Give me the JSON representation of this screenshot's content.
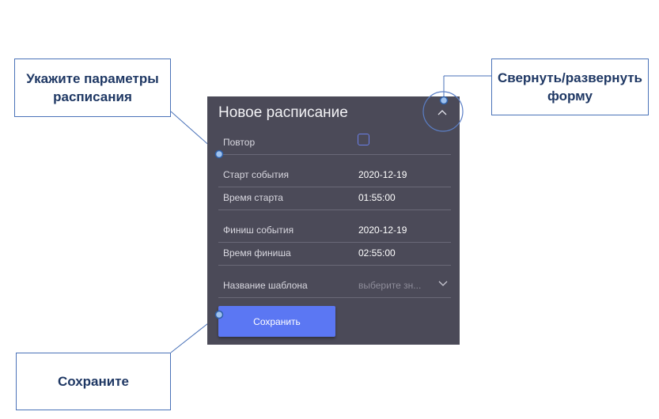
{
  "panel": {
    "title": "Новое расписание",
    "rows": [
      {
        "label": "Повтор",
        "type": "checkbox",
        "checked": false
      },
      {
        "label": "Старт события",
        "value": "2020-12-19"
      },
      {
        "label": "Время старта",
        "value": "01:55:00"
      },
      {
        "label": "Финиш события",
        "value": "2020-12-19"
      },
      {
        "label": "Время финиша",
        "value": "02:55:00"
      },
      {
        "label": "Название шаблона",
        "placeholder": "выберите зн..."
      }
    ],
    "save_label": "Сохранить",
    "colors": {
      "background": "#4b4a58",
      "button": "#5b77f3",
      "accent": "#6b7fe8"
    }
  },
  "callouts": {
    "params": {
      "line1": "Укажите параметры",
      "line2": "расписания"
    },
    "collapse": {
      "line1": "Свернуть/развернуть",
      "line2": "форму"
    },
    "save": {
      "text": "Сохраните"
    }
  },
  "icons": {
    "collapse": "chevron-up-icon",
    "dropdown": "chevron-down-icon"
  }
}
